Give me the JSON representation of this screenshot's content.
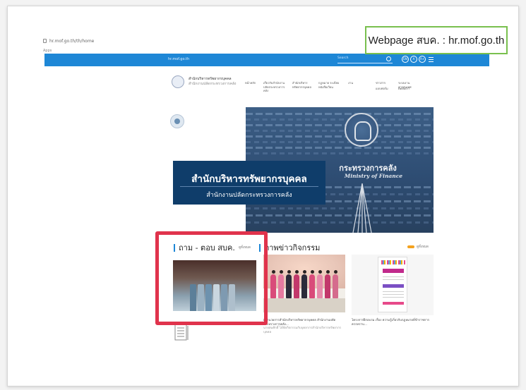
{
  "browser": {
    "url": "hr.mof.go.th/th/home",
    "apps_label": "Apps"
  },
  "caption": "Webpage สบค. : hr.mof.go.th",
  "site_header": {
    "domain": "hr.mof.go.th",
    "search_placeholder": "Search",
    "icon_labels": [
      "EN",
      "A",
      "A+"
    ],
    "org_name": "สำนักบริหารทรัพยากรบุคคล",
    "org_sub": "สำนักงานปลัดกระทรวงการคลัง",
    "nav": [
      "หน้าหลัก",
      "เกี่ยวกับสำนักงาน ปลัดกระทรวงการคลัง",
      "สำนักบริหาร ทรัพยากรบุคคล",
      "กฎหมาย ระเบียบ หนังสือเวียน",
      "งาน",
      "ระบบงานสารสนเทศ",
      "ติดต่อเรา"
    ],
    "nav_col2": [
      "ข่าวสาร",
      "แบบฟอร์ม"
    ]
  },
  "hero": {
    "building_thai": "กระทรวงการคลัง",
    "building_eng": "Ministry of Finance",
    "title": "สำนักบริหารทรัพยากรบุคคล",
    "subtitle": "สำนักงานปลัดกระทรวงการคลัง"
  },
  "qa_section": {
    "title": "ถาม - ตอบ สบค.",
    "see_all": "ดูทั้งหมด"
  },
  "activity_section": {
    "title": "ภาพข่าวกิจกรรม",
    "see_all": "ดูทั้งหมด"
  },
  "news": [
    {
      "caption": "ผู้อำนวยการสำนักบริหารทรัพยากรบุคคล สำนักงานปลัดกระทรวงการคลัง...",
      "detail": "นายสมศักดิ์ ได้จัดกิจกรรมกับบุคลากรสำนักบริหารทรัพยากรบุคคล"
    },
    {
      "caption": "โครงการฝึกอบรม เรื่อง ความรู้เกี่ยวกับกฎหมายที่ข้าราชการควรทราบ...",
      "detail": ""
    }
  ],
  "colors": {
    "accent_blue": "#1e87d6",
    "hero_band": "#0f3d6a",
    "highlight": "#e0334c",
    "caption_border": "#79c04e"
  }
}
